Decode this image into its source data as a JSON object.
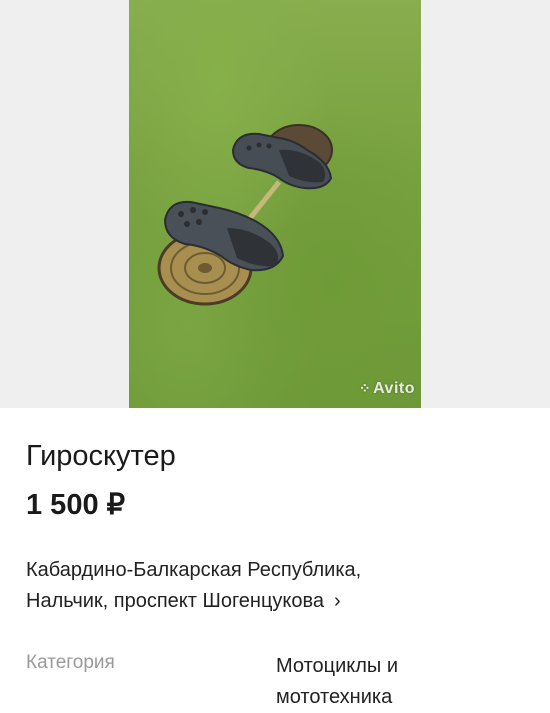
{
  "listing": {
    "photo": {
      "watermark": "Avito"
    },
    "title": "Гироскутер",
    "price": "1 500 ₽",
    "address_line1": "Кабардино-Балкарская Республика,",
    "address_line2": "Нальчик, проспект Шогенцукова",
    "category_label": "Категория",
    "category_value": "Мотоциклы и мототехника"
  },
  "icons": {
    "address_chevron": "chevron-right-icon",
    "watermark_logo": "avito-logo-icon"
  }
}
